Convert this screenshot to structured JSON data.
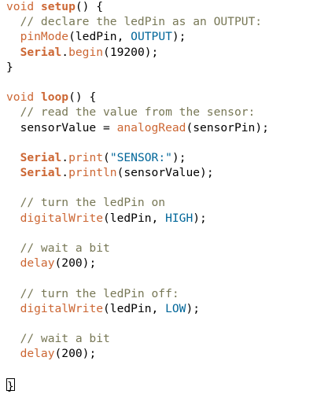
{
  "colors": {
    "background": "#ffffff",
    "text": "#000000",
    "keyword": "#cc6633",
    "comment": "#777755",
    "constant": "#006699"
  },
  "lines": [
    {
      "tokens": [
        {
          "t": "void",
          "c": "kw"
        },
        {
          "t": " "
        },
        {
          "t": "setup",
          "c": "fn"
        },
        {
          "t": "() {"
        }
      ]
    },
    {
      "tokens": [
        {
          "t": "  // declare the ledPin as an OUTPUT:",
          "c": "cm"
        }
      ]
    },
    {
      "tokens": [
        {
          "t": "  "
        },
        {
          "t": "pinMode",
          "c": "kw"
        },
        {
          "t": "(ledPin, "
        },
        {
          "t": "OUTPUT",
          "c": "const"
        },
        {
          "t": ");"
        }
      ]
    },
    {
      "tokens": [
        {
          "t": "  "
        },
        {
          "t": "Serial",
          "c": "fn"
        },
        {
          "t": "."
        },
        {
          "t": "begin",
          "c": "kw"
        },
        {
          "t": "(19200);"
        }
      ]
    },
    {
      "tokens": [
        {
          "t": "}"
        }
      ]
    },
    {
      "tokens": []
    },
    {
      "tokens": [
        {
          "t": "void",
          "c": "kw"
        },
        {
          "t": " "
        },
        {
          "t": "loop",
          "c": "fn"
        },
        {
          "t": "() {"
        }
      ]
    },
    {
      "tokens": [
        {
          "t": "  // read the value from the sensor:",
          "c": "cm"
        }
      ]
    },
    {
      "tokens": [
        {
          "t": "  sensorValue = "
        },
        {
          "t": "analogRead",
          "c": "kw"
        },
        {
          "t": "(sensorPin);"
        }
      ]
    },
    {
      "tokens": []
    },
    {
      "tokens": [
        {
          "t": "  "
        },
        {
          "t": "Serial",
          "c": "fn"
        },
        {
          "t": "."
        },
        {
          "t": "print",
          "c": "kw"
        },
        {
          "t": "("
        },
        {
          "t": "\"SENSOR:\"",
          "c": "str"
        },
        {
          "t": ");"
        }
      ]
    },
    {
      "tokens": [
        {
          "t": "  "
        },
        {
          "t": "Serial",
          "c": "fn"
        },
        {
          "t": "."
        },
        {
          "t": "println",
          "c": "kw"
        },
        {
          "t": "(sensorValue);"
        }
      ]
    },
    {
      "tokens": []
    },
    {
      "tokens": [
        {
          "t": "  // turn the ledPin on",
          "c": "cm"
        }
      ]
    },
    {
      "tokens": [
        {
          "t": "  "
        },
        {
          "t": "digitalWrite",
          "c": "kw"
        },
        {
          "t": "(ledPin, "
        },
        {
          "t": "HIGH",
          "c": "const"
        },
        {
          "t": ");"
        }
      ]
    },
    {
      "tokens": []
    },
    {
      "tokens": [
        {
          "t": "  // wait a bit",
          "c": "cm"
        }
      ]
    },
    {
      "tokens": [
        {
          "t": "  "
        },
        {
          "t": "delay",
          "c": "kw"
        },
        {
          "t": "(200);"
        }
      ]
    },
    {
      "tokens": []
    },
    {
      "tokens": [
        {
          "t": "  // turn the ledPin off:",
          "c": "cm"
        }
      ]
    },
    {
      "tokens": [
        {
          "t": "  "
        },
        {
          "t": "digitalWrite",
          "c": "kw"
        },
        {
          "t": "(ledPin, "
        },
        {
          "t": "LOW",
          "c": "const"
        },
        {
          "t": ");"
        }
      ]
    },
    {
      "tokens": []
    },
    {
      "tokens": [
        {
          "t": "  // wait a bit",
          "c": "cm"
        }
      ]
    },
    {
      "tokens": [
        {
          "t": "  "
        },
        {
          "t": "delay",
          "c": "kw"
        },
        {
          "t": "(200);"
        }
      ]
    },
    {
      "tokens": []
    },
    {
      "tokens": [
        {
          "t": "}",
          "c": "caret"
        }
      ]
    }
  ]
}
